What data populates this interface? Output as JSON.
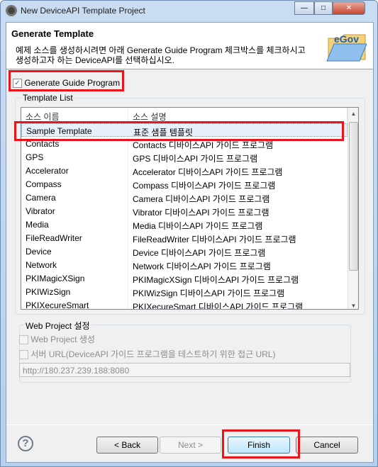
{
  "window": {
    "title": "New DeviceAPI Template Project",
    "controls": [
      "minimize",
      "maximize",
      "close"
    ]
  },
  "header": {
    "title": "Generate Template",
    "description": "예제 소스를 생성하시려면 아래 Generate Guide Program 체크박스를 체크하시고 생성하고자 하는 DeviceAPI를 선택하십시오.",
    "logo_text": "eGov"
  },
  "generate_checkbox": {
    "label": "Generate Guide Program",
    "checked": true
  },
  "template_list": {
    "label": "Template List",
    "columns": [
      "소스 이름",
      "소스 설명"
    ],
    "rows": [
      [
        "Sample Template",
        "표준 샘플 템플릿"
      ],
      [
        "Contacts",
        "Contacts 디바이스API 가이드 프로그램"
      ],
      [
        "GPS",
        "GPS 디바이스API 가이드 프로그램"
      ],
      [
        "Accelerator",
        "Accelerator 디바이스API 가이드 프로그램"
      ],
      [
        "Compass",
        "Compass 디바이스API 가이드 프로그램"
      ],
      [
        "Camera",
        "Camera 디바이스API 가이드 프로그램"
      ],
      [
        "Vibrator",
        "Vibrator 디바이스API 가이드 프로그램"
      ],
      [
        "Media",
        "Media 디바이스API 가이드 프로그램"
      ],
      [
        "FileReadWriter",
        "FileReadWriter 디바이스API 가이드 프로그램"
      ],
      [
        "Device",
        "Device 디바이스API 가이드 프로그램"
      ],
      [
        "Network",
        "Network 디바이스API 가이드 프로그램"
      ],
      [
        "PKIMagicXSign",
        "PKIMagicXSign 디바이스API 가이드 프로그램"
      ],
      [
        "PKIWizSign",
        "PKIWizSign 디바이스API 가이드 프로그램"
      ],
      [
        "PKIXecureSmart",
        "PKIXecureSmart 디바이스API 가이드 프로그램"
      ]
    ],
    "selected": "Sample Template"
  },
  "web_project": {
    "label": "Web Project 설정",
    "create_label": "Web Project 생성",
    "server_url_label": "서버 URL(DeviceAPI 가이드 프로그램을 테스트하기 위한 접근 URL)",
    "server_url_value": "http://180.237.239.188:8080"
  },
  "buttons": {
    "back": "< Back",
    "next": "Next >",
    "finish": "Finish",
    "cancel": "Cancel",
    "help": "?"
  },
  "colors": {
    "highlight": "#e8141e"
  }
}
